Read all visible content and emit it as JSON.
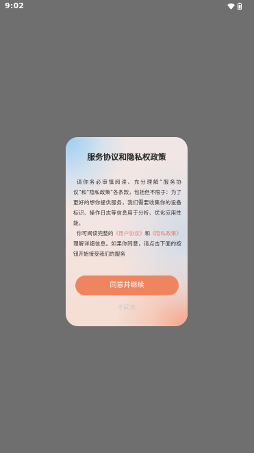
{
  "status_bar": {
    "time": "9:02",
    "icons": [
      "wifi-icon",
      "battery-icon"
    ]
  },
  "dialog": {
    "title": "服务协议和隐私权政策",
    "paragraph1": "请你务必审慎阅读、充分理解“服务协议”和“隐私政策”各条款，包括但不限于：为了更好的想你提供服务，我们需要收集你的设备标识、操作日志等信息用于分析、优化应用性能。",
    "paragraph2_prefix": "你可阅读完整的",
    "user_agreement_link": "《用户协议》",
    "paragraph2_and": "和",
    "privacy_policy_link": "《隐私政策》",
    "paragraph2_suffix": "理解详细信息。如果你同意，请点击下面的按钮开始接受我们的服务",
    "agree_label": "同意并继续",
    "disagree_label": "不同意"
  },
  "colors": {
    "overlay": "#6f6f6f",
    "accent": "#ee8560",
    "link": "#e8806c"
  }
}
